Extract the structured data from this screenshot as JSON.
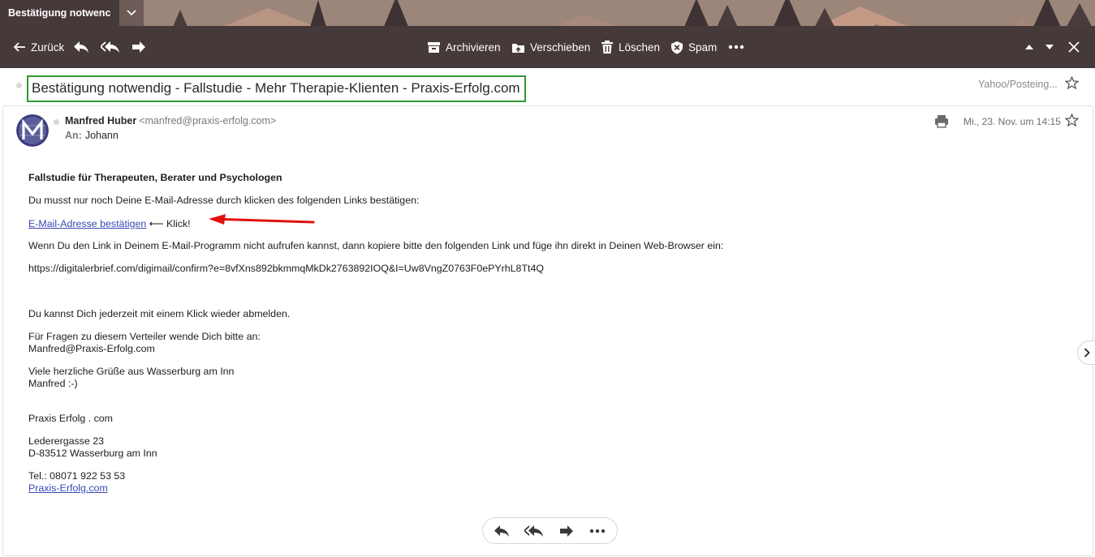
{
  "tab": {
    "title": "Bestätigung notwenc"
  },
  "toolbar": {
    "back_label": "Zurück",
    "archive_label": "Archivieren",
    "move_label": "Verschieben",
    "delete_label": "Löschen",
    "spam_label": "Spam"
  },
  "subject": "Bestätigung notwendig - Fallstudie - Mehr Therapie-Klienten - Praxis-Erfolg.com",
  "folder": "Yahoo/Posteing...",
  "message": {
    "sender_name": "Manfred Huber",
    "sender_email": "<manfred@praxis-erfolg.com>",
    "to_label": "An:",
    "to_name": "Johann",
    "date": "Mi., 23. Nov. um 14:15"
  },
  "body": {
    "heading": "Fallstudie für Therapeuten, Berater und Psychologen",
    "intro": "Du musst nur noch Deine E-Mail-Adresse durch klicken des folgenden Links bestätigen:",
    "confirm_link": "E-Mail-Adresse bestätigen",
    "click_hint": " ⟵ Klick!",
    "fallback": "Wenn Du den Link in Deinem E-Mail-Programm nicht aufrufen kannst, dann kopiere bitte den folgenden Link und füge ihn direkt in Deinen Web-Browser ein:",
    "url": "https://digitalerbrief.com/digimail/confirm?e=8vfXns892bkmmqMkDk2763892IOQ&I=Uw8VngZ0763F0ePYrhL8Tt4Q",
    "unsubscribe": "Du kannst Dich jederzeit mit einem Klick wieder abmelden.",
    "questions": "Für Fragen zu diesem Verteiler wende Dich bitte an:",
    "contact_email": "Manfred@Praxis-Erfolg.com",
    "greeting": "Viele herzliche Grüße aus Wasserburg am Inn",
    "signoff": "Manfred  :-)",
    "company": "Praxis Erfolg . com",
    "street": "Lederergasse 23",
    "city": "D-83512 Wasserburg am Inn",
    "phone": "Tel.: 08071 922 53 53",
    "website": "Praxis-Erfolg.com"
  },
  "colors": {
    "toolbar_bg": "#46393a",
    "subject_highlight": "#2f9a32",
    "link": "#3a47b3",
    "annotation_arrow": "#e01010"
  }
}
